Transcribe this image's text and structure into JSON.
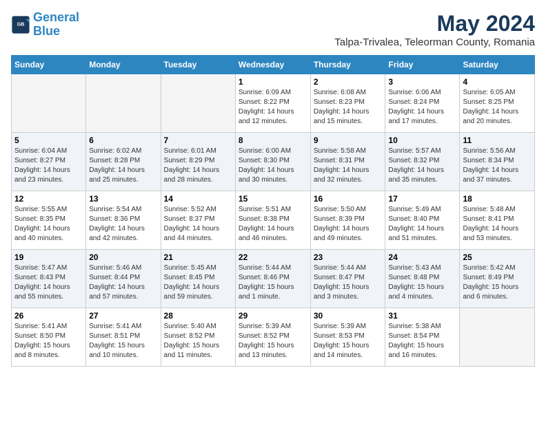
{
  "header": {
    "logo_line1": "General",
    "logo_line2": "Blue",
    "month_year": "May 2024",
    "location": "Talpa-Trivalea, Teleorman County, Romania"
  },
  "days_of_week": [
    "Sunday",
    "Monday",
    "Tuesday",
    "Wednesday",
    "Thursday",
    "Friday",
    "Saturday"
  ],
  "weeks": [
    [
      {
        "day": "",
        "info": ""
      },
      {
        "day": "",
        "info": ""
      },
      {
        "day": "",
        "info": ""
      },
      {
        "day": "1",
        "info": "Sunrise: 6:09 AM\nSunset: 8:22 PM\nDaylight: 14 hours\nand 12 minutes."
      },
      {
        "day": "2",
        "info": "Sunrise: 6:08 AM\nSunset: 8:23 PM\nDaylight: 14 hours\nand 15 minutes."
      },
      {
        "day": "3",
        "info": "Sunrise: 6:06 AM\nSunset: 8:24 PM\nDaylight: 14 hours\nand 17 minutes."
      },
      {
        "day": "4",
        "info": "Sunrise: 6:05 AM\nSunset: 8:25 PM\nDaylight: 14 hours\nand 20 minutes."
      }
    ],
    [
      {
        "day": "5",
        "info": "Sunrise: 6:04 AM\nSunset: 8:27 PM\nDaylight: 14 hours\nand 23 minutes."
      },
      {
        "day": "6",
        "info": "Sunrise: 6:02 AM\nSunset: 8:28 PM\nDaylight: 14 hours\nand 25 minutes."
      },
      {
        "day": "7",
        "info": "Sunrise: 6:01 AM\nSunset: 8:29 PM\nDaylight: 14 hours\nand 28 minutes."
      },
      {
        "day": "8",
        "info": "Sunrise: 6:00 AM\nSunset: 8:30 PM\nDaylight: 14 hours\nand 30 minutes."
      },
      {
        "day": "9",
        "info": "Sunrise: 5:58 AM\nSunset: 8:31 PM\nDaylight: 14 hours\nand 32 minutes."
      },
      {
        "day": "10",
        "info": "Sunrise: 5:57 AM\nSunset: 8:32 PM\nDaylight: 14 hours\nand 35 minutes."
      },
      {
        "day": "11",
        "info": "Sunrise: 5:56 AM\nSunset: 8:34 PM\nDaylight: 14 hours\nand 37 minutes."
      }
    ],
    [
      {
        "day": "12",
        "info": "Sunrise: 5:55 AM\nSunset: 8:35 PM\nDaylight: 14 hours\nand 40 minutes."
      },
      {
        "day": "13",
        "info": "Sunrise: 5:54 AM\nSunset: 8:36 PM\nDaylight: 14 hours\nand 42 minutes."
      },
      {
        "day": "14",
        "info": "Sunrise: 5:52 AM\nSunset: 8:37 PM\nDaylight: 14 hours\nand 44 minutes."
      },
      {
        "day": "15",
        "info": "Sunrise: 5:51 AM\nSunset: 8:38 PM\nDaylight: 14 hours\nand 46 minutes."
      },
      {
        "day": "16",
        "info": "Sunrise: 5:50 AM\nSunset: 8:39 PM\nDaylight: 14 hours\nand 49 minutes."
      },
      {
        "day": "17",
        "info": "Sunrise: 5:49 AM\nSunset: 8:40 PM\nDaylight: 14 hours\nand 51 minutes."
      },
      {
        "day": "18",
        "info": "Sunrise: 5:48 AM\nSunset: 8:41 PM\nDaylight: 14 hours\nand 53 minutes."
      }
    ],
    [
      {
        "day": "19",
        "info": "Sunrise: 5:47 AM\nSunset: 8:43 PM\nDaylight: 14 hours\nand 55 minutes."
      },
      {
        "day": "20",
        "info": "Sunrise: 5:46 AM\nSunset: 8:44 PM\nDaylight: 14 hours\nand 57 minutes."
      },
      {
        "day": "21",
        "info": "Sunrise: 5:45 AM\nSunset: 8:45 PM\nDaylight: 14 hours\nand 59 minutes."
      },
      {
        "day": "22",
        "info": "Sunrise: 5:44 AM\nSunset: 8:46 PM\nDaylight: 15 hours\nand 1 minute."
      },
      {
        "day": "23",
        "info": "Sunrise: 5:44 AM\nSunset: 8:47 PM\nDaylight: 15 hours\nand 3 minutes."
      },
      {
        "day": "24",
        "info": "Sunrise: 5:43 AM\nSunset: 8:48 PM\nDaylight: 15 hours\nand 4 minutes."
      },
      {
        "day": "25",
        "info": "Sunrise: 5:42 AM\nSunset: 8:49 PM\nDaylight: 15 hours\nand 6 minutes."
      }
    ],
    [
      {
        "day": "26",
        "info": "Sunrise: 5:41 AM\nSunset: 8:50 PM\nDaylight: 15 hours\nand 8 minutes."
      },
      {
        "day": "27",
        "info": "Sunrise: 5:41 AM\nSunset: 8:51 PM\nDaylight: 15 hours\nand 10 minutes."
      },
      {
        "day": "28",
        "info": "Sunrise: 5:40 AM\nSunset: 8:52 PM\nDaylight: 15 hours\nand 11 minutes."
      },
      {
        "day": "29",
        "info": "Sunrise: 5:39 AM\nSunset: 8:52 PM\nDaylight: 15 hours\nand 13 minutes."
      },
      {
        "day": "30",
        "info": "Sunrise: 5:39 AM\nSunset: 8:53 PM\nDaylight: 15 hours\nand 14 minutes."
      },
      {
        "day": "31",
        "info": "Sunrise: 5:38 AM\nSunset: 8:54 PM\nDaylight: 15 hours\nand 16 minutes."
      },
      {
        "day": "",
        "info": ""
      }
    ]
  ]
}
